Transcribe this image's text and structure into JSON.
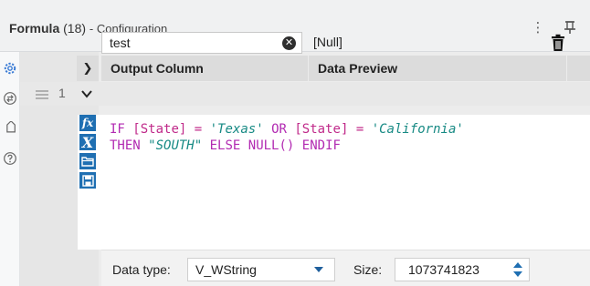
{
  "header": {
    "tool_name": "Formula",
    "tool_count": "(18)",
    "subtitle": "- Configuration",
    "menu_glyph": "⋮",
    "pin_glyph": "⊥"
  },
  "rail": {
    "items": [
      "settings-icon",
      "transfer-icon",
      "tag-icon",
      "help-icon"
    ]
  },
  "grid": {
    "expand_glyph": "❯",
    "columns": {
      "output": "Output Column",
      "preview": "Data Preview"
    },
    "rows": [
      {
        "index": "1",
        "column_name": "test",
        "preview": "[Null]"
      }
    ]
  },
  "formula": {
    "toolbar": [
      "fx-icon",
      "variable-icon",
      "open-icon",
      "save-icon"
    ],
    "line1": {
      "kw_if": "IF",
      "field1": "[State]",
      "eq1": "=",
      "str1": "'Texas'",
      "kw_or": "OR",
      "field2": "[State]",
      "eq2": "=",
      "str2": "'California'"
    },
    "line2": {
      "kw_then": "THEN",
      "str_south": "\"SOUTH\"",
      "kw_else": "ELSE",
      "fn_null": "NULL()",
      "kw_endif": "ENDIF"
    }
  },
  "footer": {
    "data_type_label": "Data type:",
    "data_type_value": "V_WString",
    "size_label": "Size:",
    "size_value": "1073741823"
  },
  "colors": {
    "accent": "#1f6fb2",
    "keyword": "#b22ab2",
    "string": "#178a84"
  }
}
